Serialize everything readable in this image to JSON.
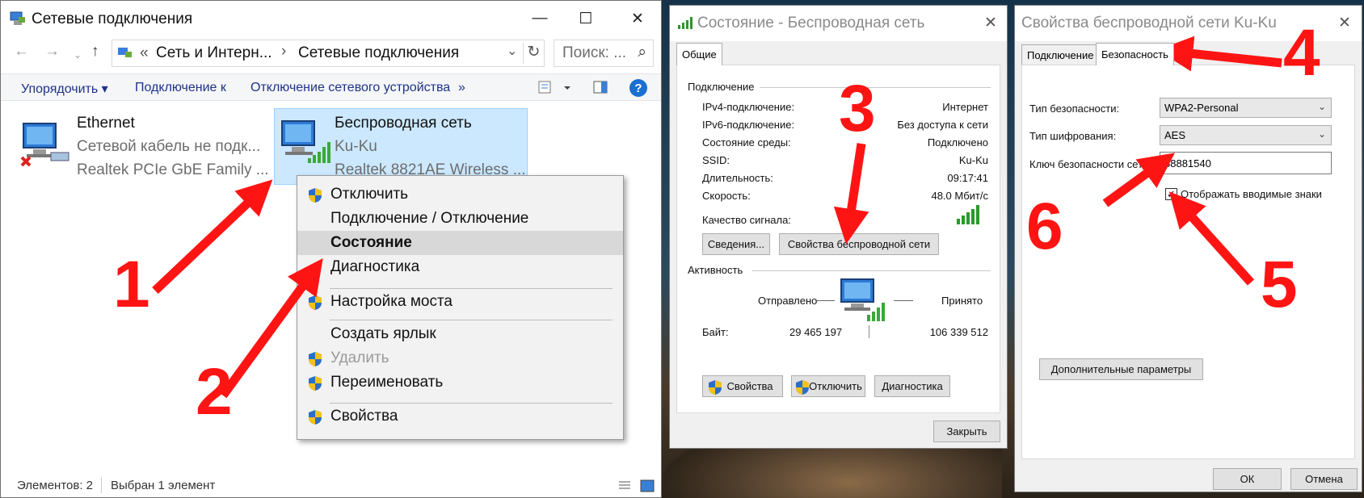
{
  "explorer": {
    "title": "Сетевые подключения",
    "controls": {
      "minimize": "—",
      "maximize": "☐",
      "close": "✕"
    },
    "address": {
      "chevron": "«",
      "part1": "Сеть и Интерн...",
      "sep": "›",
      "part2": "Сетевые подключения"
    },
    "search_placeholder": "Поиск: ...",
    "toolbar": {
      "organize": "Упорядочить ▾",
      "connect": "Подключение к",
      "disable": "Отключение сетевого устройства",
      "more": "»"
    },
    "items": [
      {
        "name": "Ethernet",
        "status": "Сетевой кабель не подк...",
        "device": "Realtek PCIe GbE Family ..."
      },
      {
        "name": "Беспроводная сеть",
        "status": "Ku-Ku",
        "device": "Realtek 8821AE Wireless ..."
      }
    ],
    "context_menu": [
      {
        "label": "Отключить"
      },
      {
        "label": "Подключение / Отключение"
      },
      {
        "label": "Состояние"
      },
      {
        "label": "Диагностика"
      },
      {
        "label": "Настройка моста"
      },
      {
        "label": "Создать ярлык"
      },
      {
        "label": "Удалить"
      },
      {
        "label": "Переименовать"
      },
      {
        "label": "Свойства"
      }
    ],
    "statusbar": {
      "count": "Элементов: 2",
      "selected": "Выбран 1 элемент"
    }
  },
  "status_dialog": {
    "title": "Состояние - Беспроводная сеть",
    "tab": "Общие",
    "connection_header": "Подключение",
    "rows": [
      {
        "label": "IPv4-подключение:",
        "value": "Интернет"
      },
      {
        "label": "IPv6-подключение:",
        "value": "Без доступа к сети"
      },
      {
        "label": "Состояние среды:",
        "value": "Подключено"
      },
      {
        "label": "SSID:",
        "value": "Ku-Ku"
      },
      {
        "label": "Длительность:",
        "value": "09:17:41"
      },
      {
        "label": "Скорость:",
        "value": "48.0 Мбит/с"
      }
    ],
    "signal_label": "Качество сигнала:",
    "btn_details": "Сведения...",
    "btn_wireless_props": "Свойства беспроводной сети",
    "activity_header": "Активность",
    "sent_label": "Отправлено",
    "received_label": "Принято",
    "bytes_label": "Байт:",
    "bytes_sent": "29 465 197",
    "bytes_received": "106 339 512",
    "btn_properties": "Свойства",
    "btn_disable": "Отключить",
    "btn_diagnose": "Диагностика",
    "btn_close": "Закрыть"
  },
  "props_dialog": {
    "title": "Свойства беспроводной сети Ku-Ku",
    "tab_connection": "Подключение",
    "tab_security": "Безопасность",
    "security_type_label": "Тип безопасности:",
    "security_type_value": "WPA2-Personal",
    "encryption_label": "Тип шифрования:",
    "encryption_value": "AES",
    "key_label": "Ключ безопасности сети",
    "key_value": "88881540",
    "show_chars_label": "Отображать вводимые знаки",
    "show_chars_checked": true,
    "btn_advanced": "Дополнительные параметры",
    "btn_ok": "ОК",
    "btn_cancel": "Отмена"
  },
  "annotations": [
    "1",
    "2",
    "3",
    "4",
    "5",
    "6"
  ],
  "colors": {
    "annotation": "#ff1414",
    "selection": "#cce8ff",
    "link": "#1e3287"
  }
}
